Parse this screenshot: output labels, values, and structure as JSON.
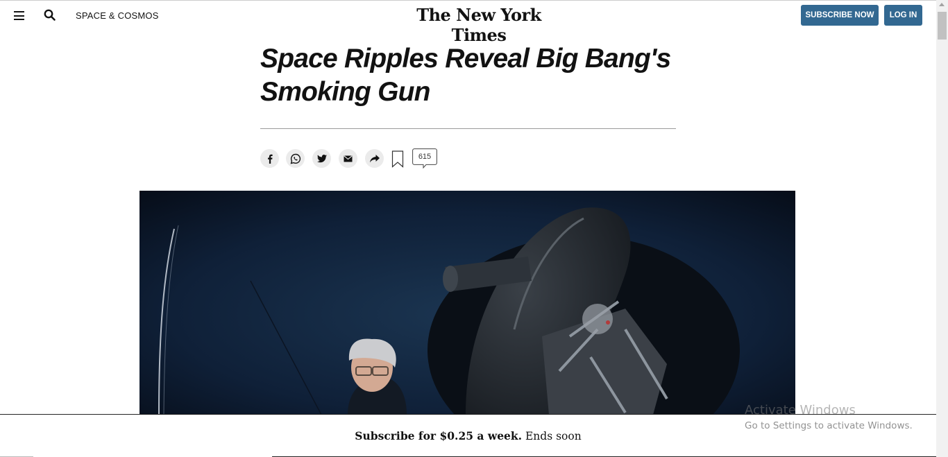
{
  "header": {
    "section_label": "SPACE & COSMOS",
    "logo_text": "The New York Times",
    "subscribe_label": "SUBSCRIBE NOW",
    "login_label": "LOG IN"
  },
  "article": {
    "headline_line1": "Space Ripples Reveal Big Bang's",
    "headline_line2": "Smoking Gun"
  },
  "share": {
    "icons": [
      "facebook-icon",
      "whatsapp-icon",
      "twitter-icon",
      "email-icon",
      "share-icon",
      "bookmark-icon"
    ],
    "comment_count": "615"
  },
  "banner": {
    "strong_text": "Subscribe for $0.25 a week.",
    "light_text": " Ends soon"
  },
  "watermark": {
    "title": "Activate Windows",
    "subtitle": "Go to Settings to activate Windows."
  },
  "colors": {
    "accent": "#326891",
    "text": "#121212"
  }
}
